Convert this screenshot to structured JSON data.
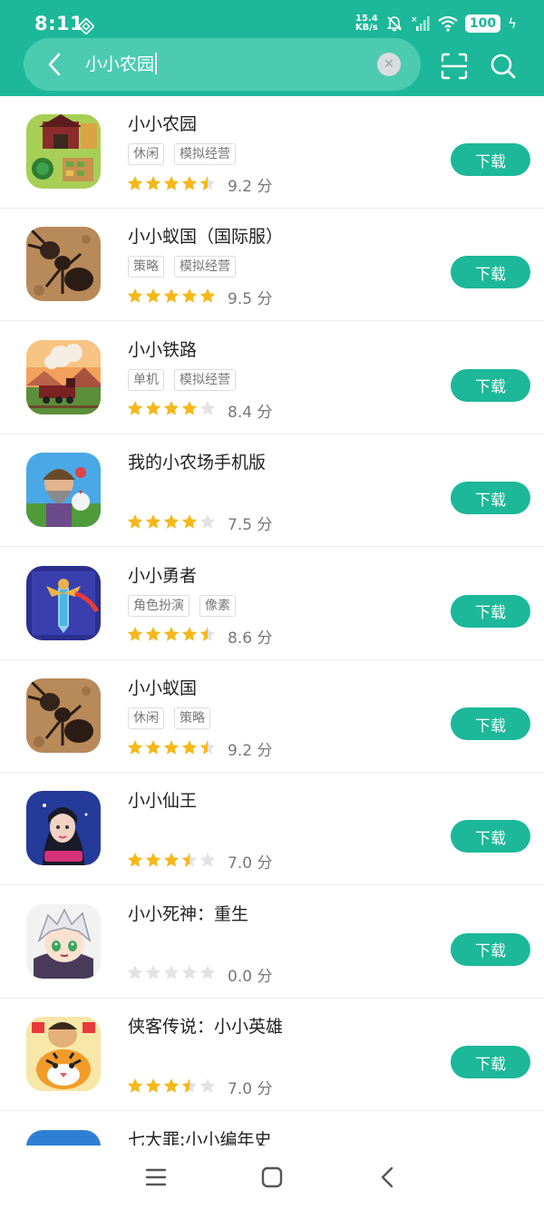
{
  "status_bar": {
    "time": "8:11",
    "net_speed_value": "15.4",
    "net_speed_unit": "KB/s",
    "battery": "100"
  },
  "search": {
    "query": "小小农园",
    "icons": [
      "back-arrow-icon",
      "clear-icon",
      "scan-icon",
      "search-icon"
    ]
  },
  "results": [
    {
      "title": "小小农园",
      "tags": [
        "休闲",
        "模拟经营"
      ],
      "stars": 4.5,
      "score": "9.2 分",
      "download_label": "下载"
    },
    {
      "title": "小小蚁国（国际服）",
      "tags": [
        "策略",
        "模拟经营"
      ],
      "stars": 5,
      "score": "9.5 分",
      "download_label": "下载"
    },
    {
      "title": "小小铁路",
      "tags": [
        "单机",
        "模拟经营"
      ],
      "stars": 4,
      "score": "8.4 分",
      "download_label": "下载"
    },
    {
      "title": "我的小农场手机版",
      "tags": [],
      "stars": 4,
      "score": "7.5 分",
      "download_label": "下载"
    },
    {
      "title": "小小勇者",
      "tags": [
        "角色扮演",
        "像素"
      ],
      "stars": 4.5,
      "score": "8.6 分",
      "download_label": "下载"
    },
    {
      "title": "小小蚁国",
      "tags": [
        "休闲",
        "策略"
      ],
      "stars": 4.5,
      "score": "9.2 分",
      "download_label": "下载"
    },
    {
      "title": "小小仙王",
      "tags": [],
      "stars": 3.5,
      "score": "7.0 分",
      "download_label": "下载"
    },
    {
      "title": "小小死神：重生",
      "tags": [],
      "stars": 0,
      "score": "0.0 分",
      "download_label": "下载"
    },
    {
      "title": "侠客传说：小小英雄",
      "tags": [],
      "stars": 3.5,
      "score": "7.0 分",
      "download_label": "下载"
    },
    {
      "title": "七大罪:小小编年史",
      "tags": [],
      "stars": null,
      "score": "",
      "download_label": ""
    }
  ],
  "colors": {
    "primary": "#1cb899",
    "star_on": "#f5b81c",
    "star_off": "#e3e3e3"
  },
  "navbar": {
    "icons": [
      "menu-icon",
      "home-icon",
      "back-icon"
    ]
  }
}
